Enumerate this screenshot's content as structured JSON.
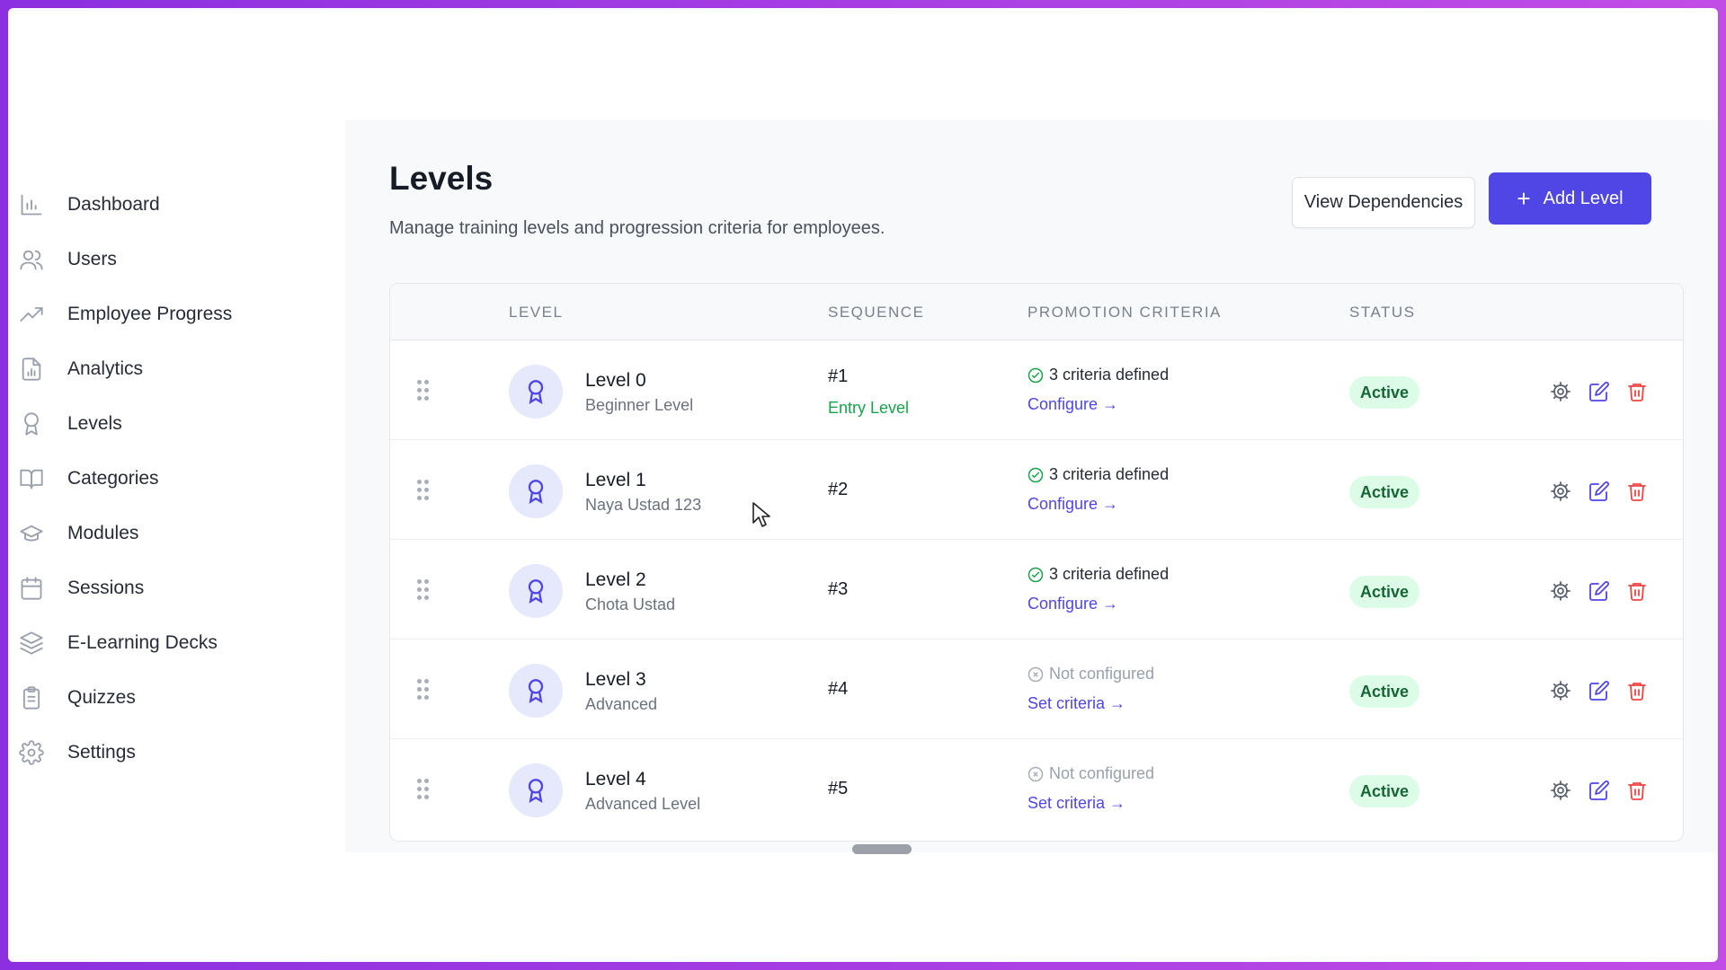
{
  "sidebar": {
    "items": [
      {
        "label": "Dashboard",
        "icon": "bar-chart-icon"
      },
      {
        "label": "Users",
        "icon": "users-icon"
      },
      {
        "label": "Employee Progress",
        "icon": "trending-up-icon"
      },
      {
        "label": "Analytics",
        "icon": "report-icon"
      },
      {
        "label": "Levels",
        "icon": "award-icon"
      },
      {
        "label": "Categories",
        "icon": "book-icon"
      },
      {
        "label": "Modules",
        "icon": "graduation-cap-icon"
      },
      {
        "label": "Sessions",
        "icon": "calendar-icon"
      },
      {
        "label": "E-Learning Decks",
        "icon": "layers-icon"
      },
      {
        "label": "Quizzes",
        "icon": "clipboard-icon"
      },
      {
        "label": "Settings",
        "icon": "gear-icon"
      }
    ]
  },
  "header": {
    "title": "Levels",
    "subtitle": "Manage training levels and progression criteria for employees.",
    "view_dependencies_label": "View Dependencies",
    "add_level_label": "Add Level"
  },
  "table": {
    "columns": [
      "LEVEL",
      "SEQUENCE",
      "PROMOTION CRITERIA",
      "STATUS"
    ],
    "rows": [
      {
        "name": "Level 0",
        "desc": "Beginner Level",
        "seq": "#1",
        "seq_note": "Entry Level",
        "criteria": "3 criteria defined",
        "criteria_ok": true,
        "link": "Configure →",
        "status": "Active"
      },
      {
        "name": "Level 1",
        "desc": "Naya Ustad 123",
        "seq": "#2",
        "seq_note": "",
        "criteria": "3 criteria defined",
        "criteria_ok": true,
        "link": "Configure →",
        "status": "Active"
      },
      {
        "name": "Level 2",
        "desc": "Chota Ustad",
        "seq": "#3",
        "seq_note": "",
        "criteria": "3 criteria defined",
        "criteria_ok": true,
        "link": "Configure →",
        "status": "Active"
      },
      {
        "name": "Level 3",
        "desc": "Advanced",
        "seq": "#4",
        "seq_note": "",
        "criteria": "Not configured",
        "criteria_ok": false,
        "link": "Set criteria →",
        "status": "Active"
      },
      {
        "name": "Level 4",
        "desc": "Advanced Level",
        "seq": "#5",
        "seq_note": "",
        "criteria": "Not configured",
        "criteria_ok": false,
        "link": "Set criteria →",
        "status": "Active"
      }
    ]
  },
  "colors": {
    "accent": "#4f46e5",
    "success": "#16a34a",
    "status_bg": "#dcfce7",
    "danger": "#ef4444",
    "frame_gradient_start": "#8b2fe0",
    "frame_gradient_end": "#c24de6"
  }
}
